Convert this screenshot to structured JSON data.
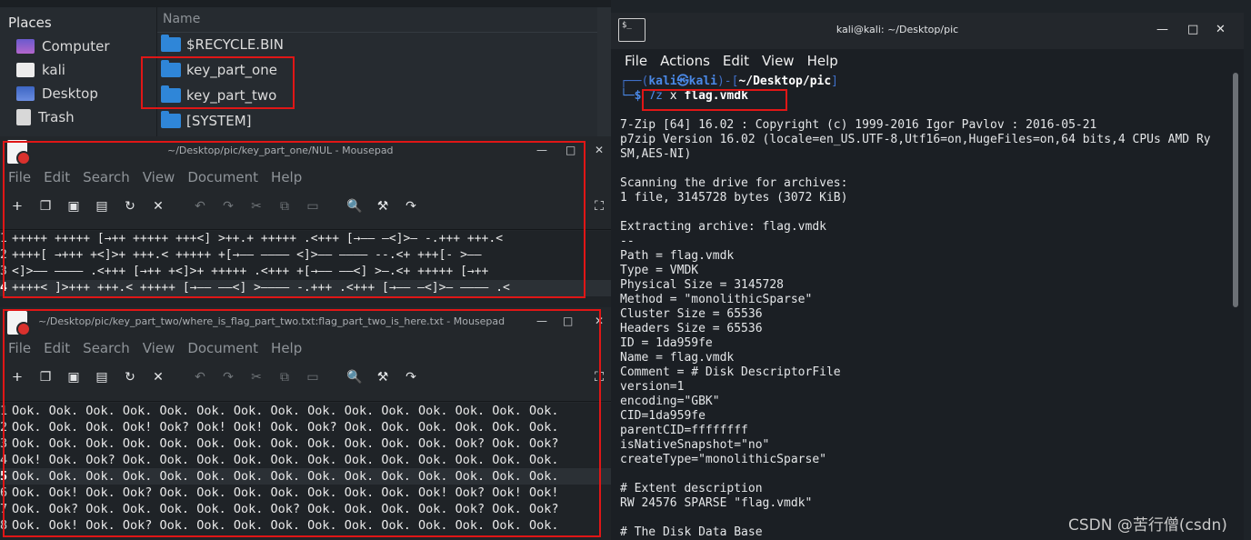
{
  "file_manager": {
    "places_title": "Places",
    "places": [
      {
        "label": "Computer",
        "icon": "computer-icon"
      },
      {
        "label": "kali",
        "icon": "home-icon"
      },
      {
        "label": "Desktop",
        "icon": "desktop-icon"
      },
      {
        "label": "Trash",
        "icon": "trash-icon"
      }
    ],
    "column_header": "Name",
    "items": [
      "$RECYCLE.BIN",
      "key_part_one",
      "key_part_two",
      "[SYSTEM]"
    ]
  },
  "mousepad_one": {
    "title": "~/Desktop/pic/key_part_one/NUL - Mousepad",
    "menu": [
      "File",
      "Edit",
      "Search",
      "View",
      "Document",
      "Help"
    ],
    "lines": [
      "+++++ +++++ [→++ +++++ +++<] >++.+ +++++ .<+++ [→—— —<]>— -.+++ +++.<",
      "++++[ →+++ +<]>+ +++.< +++++ +[→—— ———— <]>—— ———— --.<+ +++[- >——",
      "<]>—— ———— .<+++ [→++ +<]>+ +++++ .<+++ +[→—— ——<] >—.<+ +++++ [→++",
      "++++< ]>+++ +++.< +++++ [→—— ——<] >———— -.+++ .<+++ [→—— —<]>— ———— .<"
    ],
    "current_line": 4
  },
  "mousepad_two": {
    "title": "~/Desktop/pic/key_part_two/where_is_flag_part_two.txt:flag_part_two_is_here.txt - Mousepad",
    "menu": [
      "File",
      "Edit",
      "Search",
      "View",
      "Document",
      "Help"
    ],
    "lines": [
      "Ook. Ook. Ook. Ook. Ook. Ook. Ook. Ook. Ook. Ook. Ook. Ook. Ook. Ook. Ook.",
      "Ook. Ook. Ook. Ook! Ook? Ook! Ook! Ook. Ook? Ook. Ook. Ook. Ook. Ook. Ook.",
      "Ook. Ook. Ook. Ook. Ook. Ook. Ook. Ook. Ook. Ook. Ook. Ook. Ook? Ook. Ook?",
      "Ook! Ook. Ook? Ook. Ook. Ook. Ook. Ook. Ook. Ook. Ook. Ook. Ook. Ook. Ook.",
      "Ook. Ook. Ook. Ook. Ook. Ook. Ook. Ook. Ook. Ook. Ook. Ook. Ook. Ook. Ook.",
      "Ook. Ook! Ook. Ook? Ook. Ook. Ook. Ook. Ook. Ook. Ook. Ook! Ook? Ook! Ook!",
      "Ook. Ook? Ook. Ook. Ook. Ook. Ook. Ook? Ook. Ook. Ook. Ook. Ook? Ook. Ook?",
      "Ook. Ook! Ook. Ook? Ook. Ook. Ook. Ook. Ook. Ook. Ook. Ook. Ook. Ook. Ook."
    ],
    "current_line": 5
  },
  "terminal": {
    "title": "kali@kali: ~/Desktop/pic",
    "icon_text": "$_",
    "menu": [
      "File",
      "Actions",
      "Edit",
      "View",
      "Help"
    ],
    "prompt": {
      "open": "┌──(",
      "user": "kali㉿kali",
      "close": ")-[",
      "path": "~/Desktop/pic",
      "end": "]",
      "second": "└─$",
      "cmd_bin": "7z",
      "cmd_arg": "x",
      "cmd_file": "flag.vmdk"
    },
    "output": [
      "",
      "7-Zip [64] 16.02 : Copyright (c) 1999-2016 Igor Pavlov : 2016-05-21",
      "p7zip Version 16.02 (locale=en_US.UTF-8,Utf16=on,HugeFiles=on,64 bits,4 CPUs AMD Ry",
      "SM,AES-NI)",
      "",
      "Scanning the drive for archives:",
      "1 file, 3145728 bytes (3072 KiB)",
      "",
      "Extracting archive: flag.vmdk",
      "--",
      "Path = flag.vmdk",
      "Type = VMDK",
      "Physical Size = 3145728",
      "Method = \"monolithicSparse\"",
      "Cluster Size = 65536",
      "Headers Size = 65536",
      "ID = 1da959fe",
      "Name = flag.vmdk",
      "Comment = # Disk DescriptorFile",
      "version=1",
      "encoding=\"GBK\"",
      "CID=1da959fe",
      "parentCID=ffffffff",
      "isNativeSnapshot=\"no\"",
      "createType=\"monolithicSparse\"",
      "",
      "# Extent description",
      "RW 24576 SPARSE \"flag.vmdk\"",
      "",
      "# The Disk Data Base"
    ]
  },
  "watermark": "CSDN @苦行僧(csdn)",
  "colors": {
    "highlight": "#e01616",
    "folder": "#2f86d8",
    "prompt_blue": "#4a88e6"
  }
}
